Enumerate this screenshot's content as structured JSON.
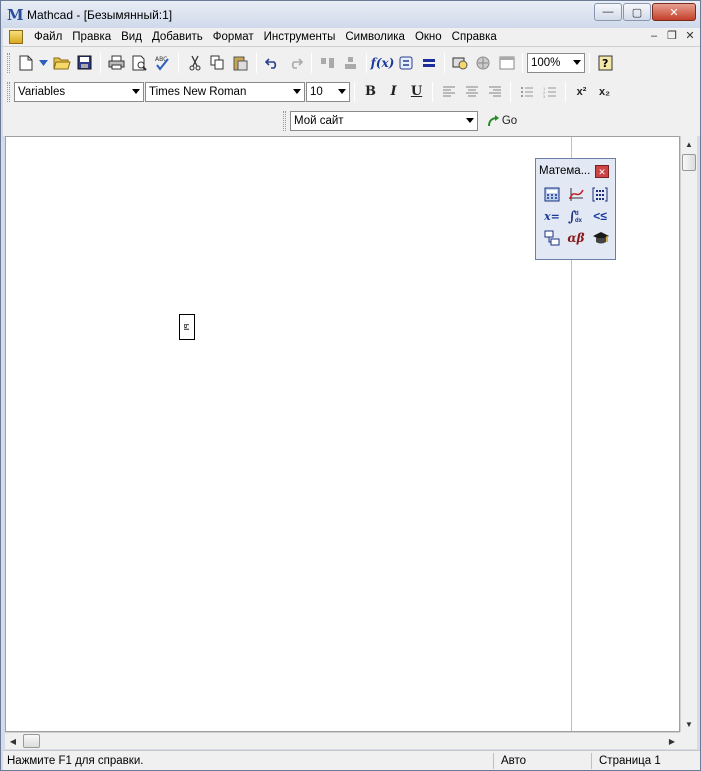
{
  "window": {
    "title": "Mathcad - [Безымянный:1]",
    "logo_letter": "M",
    "controls": {
      "minimize": "—",
      "maximize": "▢",
      "close": "✕"
    }
  },
  "menubar": {
    "items": [
      "Файл",
      "Правка",
      "Вид",
      "Добавить",
      "Формат",
      "Инструменты",
      "Символика",
      "Окно",
      "Справка"
    ],
    "mdi_controls": {
      "minimize": "–",
      "restore": "❐",
      "close": "✕"
    }
  },
  "standard_toolbar": {
    "zoom_value": "100%",
    "icons": [
      "new-doc-icon",
      "open-icon",
      "save-icon",
      "print-icon",
      "print-preview-icon",
      "spellcheck-icon",
      "cut-icon",
      "copy-icon",
      "paste-icon",
      "undo-icon",
      "redo-icon",
      "align-top-icon",
      "align-down-icon",
      "insert-function-icon",
      "insert-unit-icon",
      "calculate-icon",
      "component-icon",
      "resources-icon",
      "window-icon",
      "help-icon"
    ]
  },
  "formatting_toolbar": {
    "style_value": "Variables",
    "font_value": "Times New Roman",
    "size_value": "10",
    "bold": "B",
    "italic": "I",
    "underline": "U",
    "superscript": "x²",
    "subscript": "x₂"
  },
  "web_toolbar": {
    "address_value": "Мой сайт",
    "go_label": "Go"
  },
  "math_palette": {
    "title": "Матема...",
    "buttons": [
      "calculator-icon",
      "graph-icon",
      "matrix-icon",
      "evaluation-icon",
      "calculus-icon",
      "boolean-icon",
      "programming-icon",
      "greek-icon",
      "symbolic-icon"
    ]
  },
  "document": {
    "placeholder_text": "ы"
  },
  "statusbar": {
    "help_text": "Нажмите F1 для справки.",
    "mode": "Авто",
    "page": "Страница 1"
  }
}
